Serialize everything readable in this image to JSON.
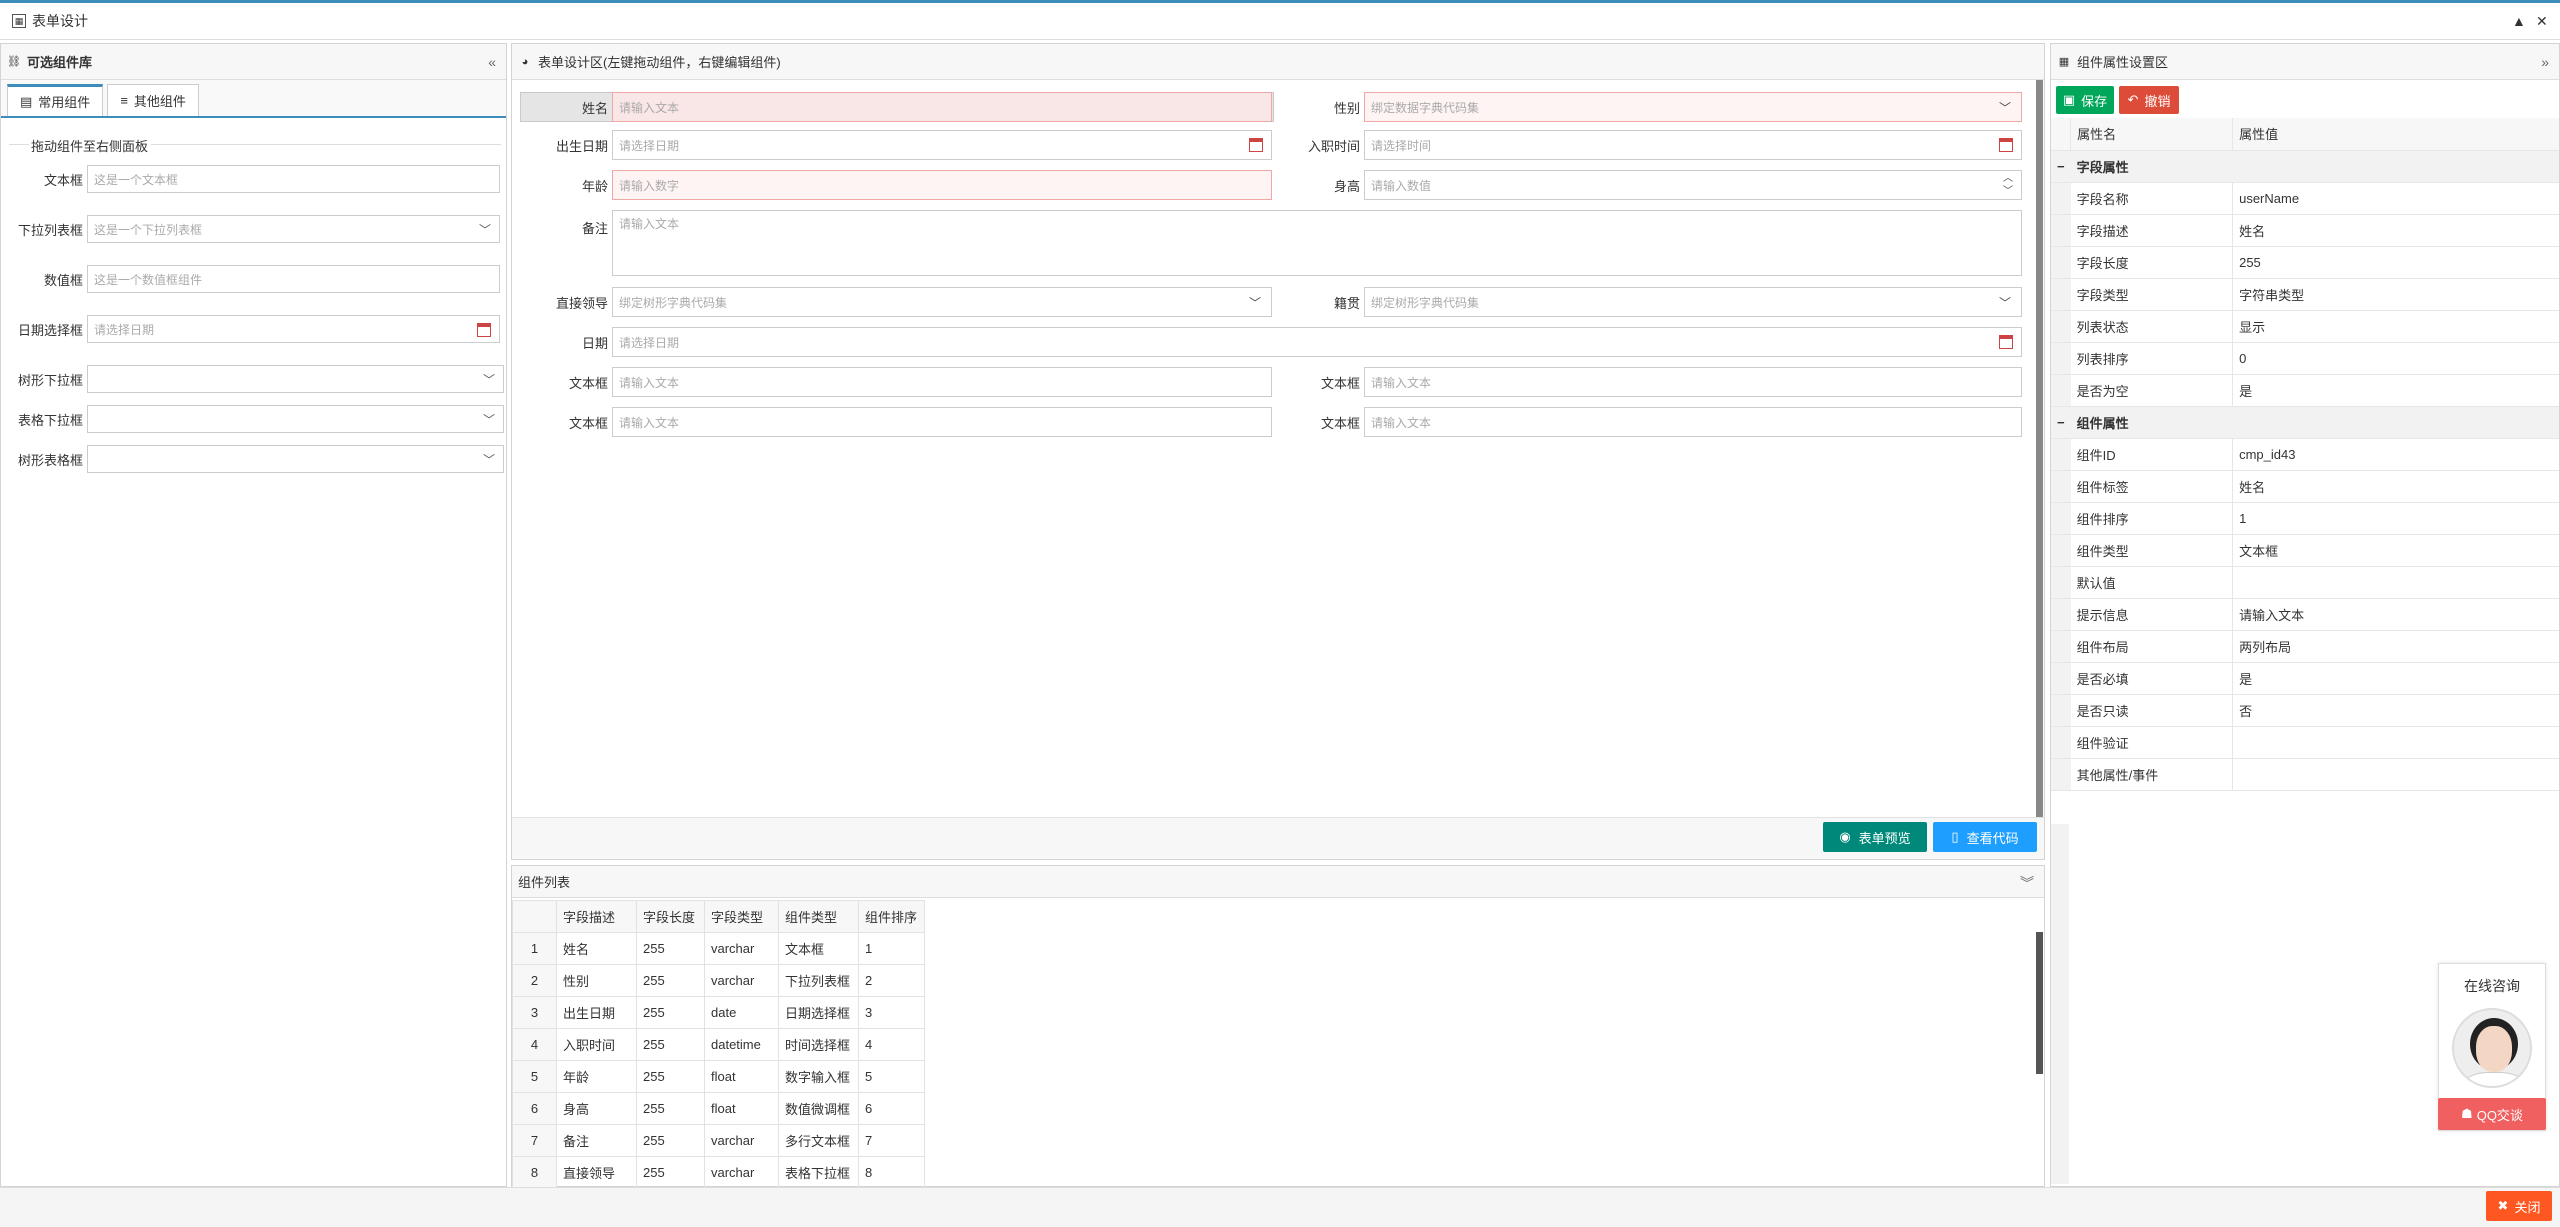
{
  "window": {
    "title": "表单设计",
    "minimize": "▲",
    "close": "✕"
  },
  "library": {
    "title": "可选组件库",
    "tabs": [
      "常用组件",
      "其他组件"
    ],
    "legend": "拖动组件至右侧面板",
    "rows": [
      {
        "label": "文本框",
        "placeholder": "这是一个文本框"
      },
      {
        "label": "下拉列表框",
        "placeholder": "这是一个下拉列表框"
      },
      {
        "label": "数值框",
        "placeholder": "这是一个数值框组件"
      },
      {
        "label": "日期选择框",
        "placeholder": "请选择日期"
      },
      {
        "label": "树形下拉框",
        "placeholder": ""
      },
      {
        "label": "表格下拉框",
        "placeholder": ""
      },
      {
        "label": "树形表格框",
        "placeholder": ""
      }
    ]
  },
  "designer": {
    "title": "表单设计区(左键拖动组件，右键编辑组件)",
    "fields": {
      "name": {
        "label": "姓名",
        "placeholder": "请输入文本"
      },
      "gender": {
        "label": "性别",
        "placeholder": "绑定数据字典代码集"
      },
      "birth": {
        "label": "出生日期",
        "placeholder": "请选择日期"
      },
      "join": {
        "label": "入职时间",
        "placeholder": "请选择时间"
      },
      "age": {
        "label": "年龄",
        "placeholder": "请输入数字"
      },
      "height": {
        "label": "身高",
        "placeholder": "请输入数值"
      },
      "note": {
        "label": "备注",
        "placeholder": "请输入文本"
      },
      "leader": {
        "label": "直接领导",
        "placeholder": "绑定树形字典代码集"
      },
      "origin": {
        "label": "籍贯",
        "placeholder": "绑定树形字典代码集"
      },
      "date": {
        "label": "日期",
        "placeholder": "请选择日期"
      },
      "text1": {
        "label": "文本框",
        "placeholder": "请输入文本"
      },
      "text2": {
        "label": "文本框",
        "placeholder": "请输入文本"
      },
      "text3": {
        "label": "文本框",
        "placeholder": "请输入文本"
      },
      "text4": {
        "label": "文本框",
        "placeholder": "请输入文本"
      }
    },
    "preview_btn": "表单预览",
    "code_btn": "查看代码"
  },
  "component_list": {
    "title": "组件列表",
    "columns": [
      "字段描述",
      "字段长度",
      "字段类型",
      "组件类型",
      "组件排序"
    ],
    "rows": [
      [
        "1",
        "姓名",
        "255",
        "varchar",
        "文本框",
        "1"
      ],
      [
        "2",
        "性别",
        "255",
        "varchar",
        "下拉列表框",
        "2"
      ],
      [
        "3",
        "出生日期",
        "255",
        "date",
        "日期选择框",
        "3"
      ],
      [
        "4",
        "入职时间",
        "255",
        "datetime",
        "时间选择框",
        "4"
      ],
      [
        "5",
        "年龄",
        "255",
        "float",
        "数字输入框",
        "5"
      ],
      [
        "6",
        "身高",
        "255",
        "float",
        "数值微调框",
        "6"
      ],
      [
        "7",
        "备注",
        "255",
        "varchar",
        "多行文本框",
        "7"
      ],
      [
        "8",
        "直接领导",
        "255",
        "varchar",
        "表格下拉框",
        "8"
      ]
    ]
  },
  "props": {
    "title": "组件属性设置区",
    "save": "保存",
    "undo": "撤销",
    "col_name": "属性名",
    "col_value": "属性值",
    "field_group": "字段属性",
    "field_rows": [
      [
        "字段名称",
        "userName"
      ],
      [
        "字段描述",
        "姓名"
      ],
      [
        "字段长度",
        "255"
      ],
      [
        "字段类型",
        "字符串类型"
      ],
      [
        "列表状态",
        "显示"
      ],
      [
        "列表排序",
        "0"
      ],
      [
        "是否为空",
        "是"
      ]
    ],
    "comp_group": "组件属性",
    "comp_rows": [
      [
        "组件ID",
        "cmp_id43"
      ],
      [
        "组件标签",
        "姓名"
      ],
      [
        "组件排序",
        "1"
      ],
      [
        "组件类型",
        "文本框"
      ],
      [
        "默认值",
        ""
      ],
      [
        "提示信息",
        "请输入文本"
      ],
      [
        "组件布局",
        "两列布局"
      ],
      [
        "是否必填",
        "是"
      ],
      [
        "是否只读",
        "否"
      ],
      [
        "组件验证",
        ""
      ],
      [
        "其他属性/事件",
        ""
      ]
    ]
  },
  "qq": {
    "title": "在线咨询",
    "button": "QQ交谈"
  },
  "footer": {
    "close": "关闭"
  },
  "colors": {
    "accent": "#3c8dbc",
    "save": "#00a65a",
    "undo": "#dd4b39",
    "preview": "#00897b",
    "code": "#1e9fff",
    "close": "#ff5722"
  }
}
